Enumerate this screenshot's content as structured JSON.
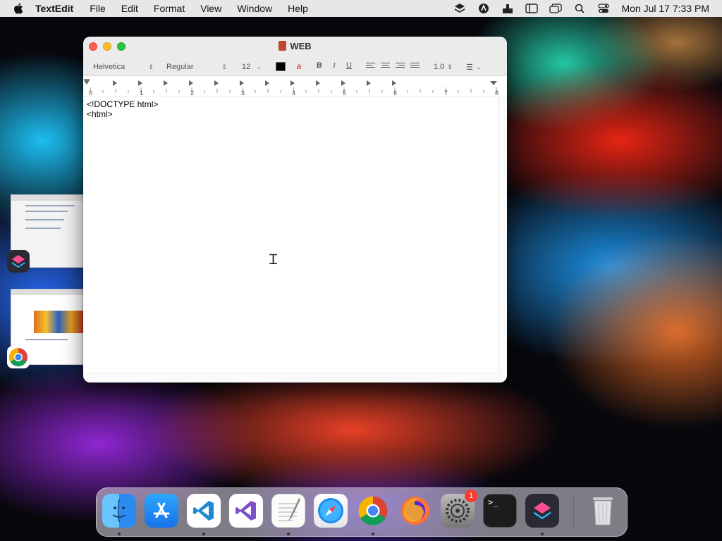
{
  "menubar": {
    "app_name": "TextEdit",
    "menus": [
      "File",
      "Edit",
      "Format",
      "View",
      "Window",
      "Help"
    ],
    "status_icons": [
      "layers-icon",
      "adobe-icon",
      "upload-icon",
      "sidebar-icon",
      "window-icon",
      "search-icon",
      "control-center-icon"
    ],
    "clock": "Mon Jul 17  7:33 PM"
  },
  "window": {
    "title": "WEB",
    "toolbar": {
      "font_family": "Helvetica",
      "font_style": "Regular",
      "font_size": "12",
      "text_color": "#000000",
      "bold": "B",
      "italic": "I",
      "underline": "U",
      "line_spacing": "1.0",
      "alignments": [
        "align-left",
        "align-center",
        "align-right",
        "align-justify"
      ]
    },
    "ruler": {
      "labels": [
        "0",
        "1",
        "2",
        "3",
        "4",
        "5",
        "6",
        "7",
        "8"
      ]
    },
    "editor_lines": [
      "<!DOCTYPE html>",
      "<html>"
    ]
  },
  "dock": {
    "apps": [
      {
        "name": "Finder",
        "icon": "finder-icon",
        "running": true
      },
      {
        "name": "App Store",
        "icon": "app-store-icon",
        "running": false
      },
      {
        "name": "Visual Studio Code",
        "icon": "vscode-icon",
        "running": true
      },
      {
        "name": "Visual Studio",
        "icon": "visual-studio-icon",
        "running": false
      },
      {
        "name": "TextEdit",
        "icon": "textedit-icon",
        "running": true
      },
      {
        "name": "Safari",
        "icon": "safari-icon",
        "running": false
      },
      {
        "name": "Google Chrome",
        "icon": "chrome-icon",
        "running": true
      },
      {
        "name": "Firefox",
        "icon": "firefox-icon",
        "running": false
      },
      {
        "name": "System Preferences",
        "icon": "system-preferences-icon",
        "running": false,
        "badge": "1"
      },
      {
        "name": "Terminal",
        "icon": "terminal-icon",
        "running": false
      },
      {
        "name": "Shortcuts",
        "icon": "shortcuts-icon",
        "running": true
      }
    ],
    "trash": "Trash"
  }
}
